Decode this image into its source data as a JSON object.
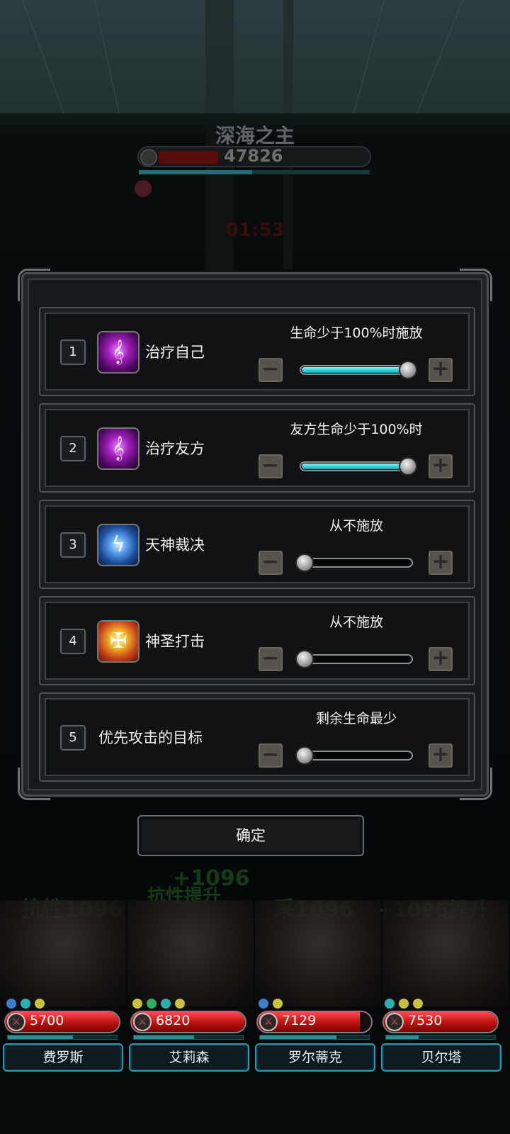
{
  "boss": {
    "name": "深海之主",
    "hp": "47826",
    "timer": "01:53"
  },
  "rows": [
    {
      "index": "1",
      "skill": "治疗自己",
      "condition": "生命少于100%时施放",
      "icon": "heal-icon",
      "level": 1.0
    },
    {
      "index": "2",
      "skill": "治疗友方",
      "condition": "友方生命少于100%时",
      "icon": "heal-icon",
      "level": 1.0
    },
    {
      "index": "3",
      "skill": "天神裁决",
      "condition": "从不施放",
      "icon": "lightning-icon",
      "level": 0.0
    },
    {
      "index": "4",
      "skill": "神圣打击",
      "condition": "从不施放",
      "icon": "holy-strike-icon",
      "level": 0.0
    },
    {
      "index": "5",
      "skill": "优先攻击的目标",
      "condition": "剩余生命最少",
      "icon": "",
      "level": 0.0
    }
  ],
  "controls": {
    "minus": "−",
    "plus": "+"
  },
  "confirm_label": "确定",
  "floats": [
    "抗性1096",
    "+1096",
    "抗性提升",
    "采1096",
    "+1096提升"
  ],
  "heroes": [
    {
      "name": "费罗斯",
      "hp": "5700",
      "hp_fraction": 1.0,
      "mana_fraction": 0.6
    },
    {
      "name": "艾莉森",
      "hp": "6820",
      "hp_fraction": 1.0,
      "mana_fraction": 0.55
    },
    {
      "name": "罗尔蒂克",
      "hp": "7129",
      "hp_fraction": 0.9,
      "mana_fraction": 0.7
    },
    {
      "name": "贝尔塔",
      "hp": "7530",
      "hp_fraction": 1.0,
      "mana_fraction": 0.3
    }
  ],
  "colors": {
    "accent": "#17a4b4",
    "hp": "#b40b0b",
    "name_border": "#2a9bb0"
  }
}
